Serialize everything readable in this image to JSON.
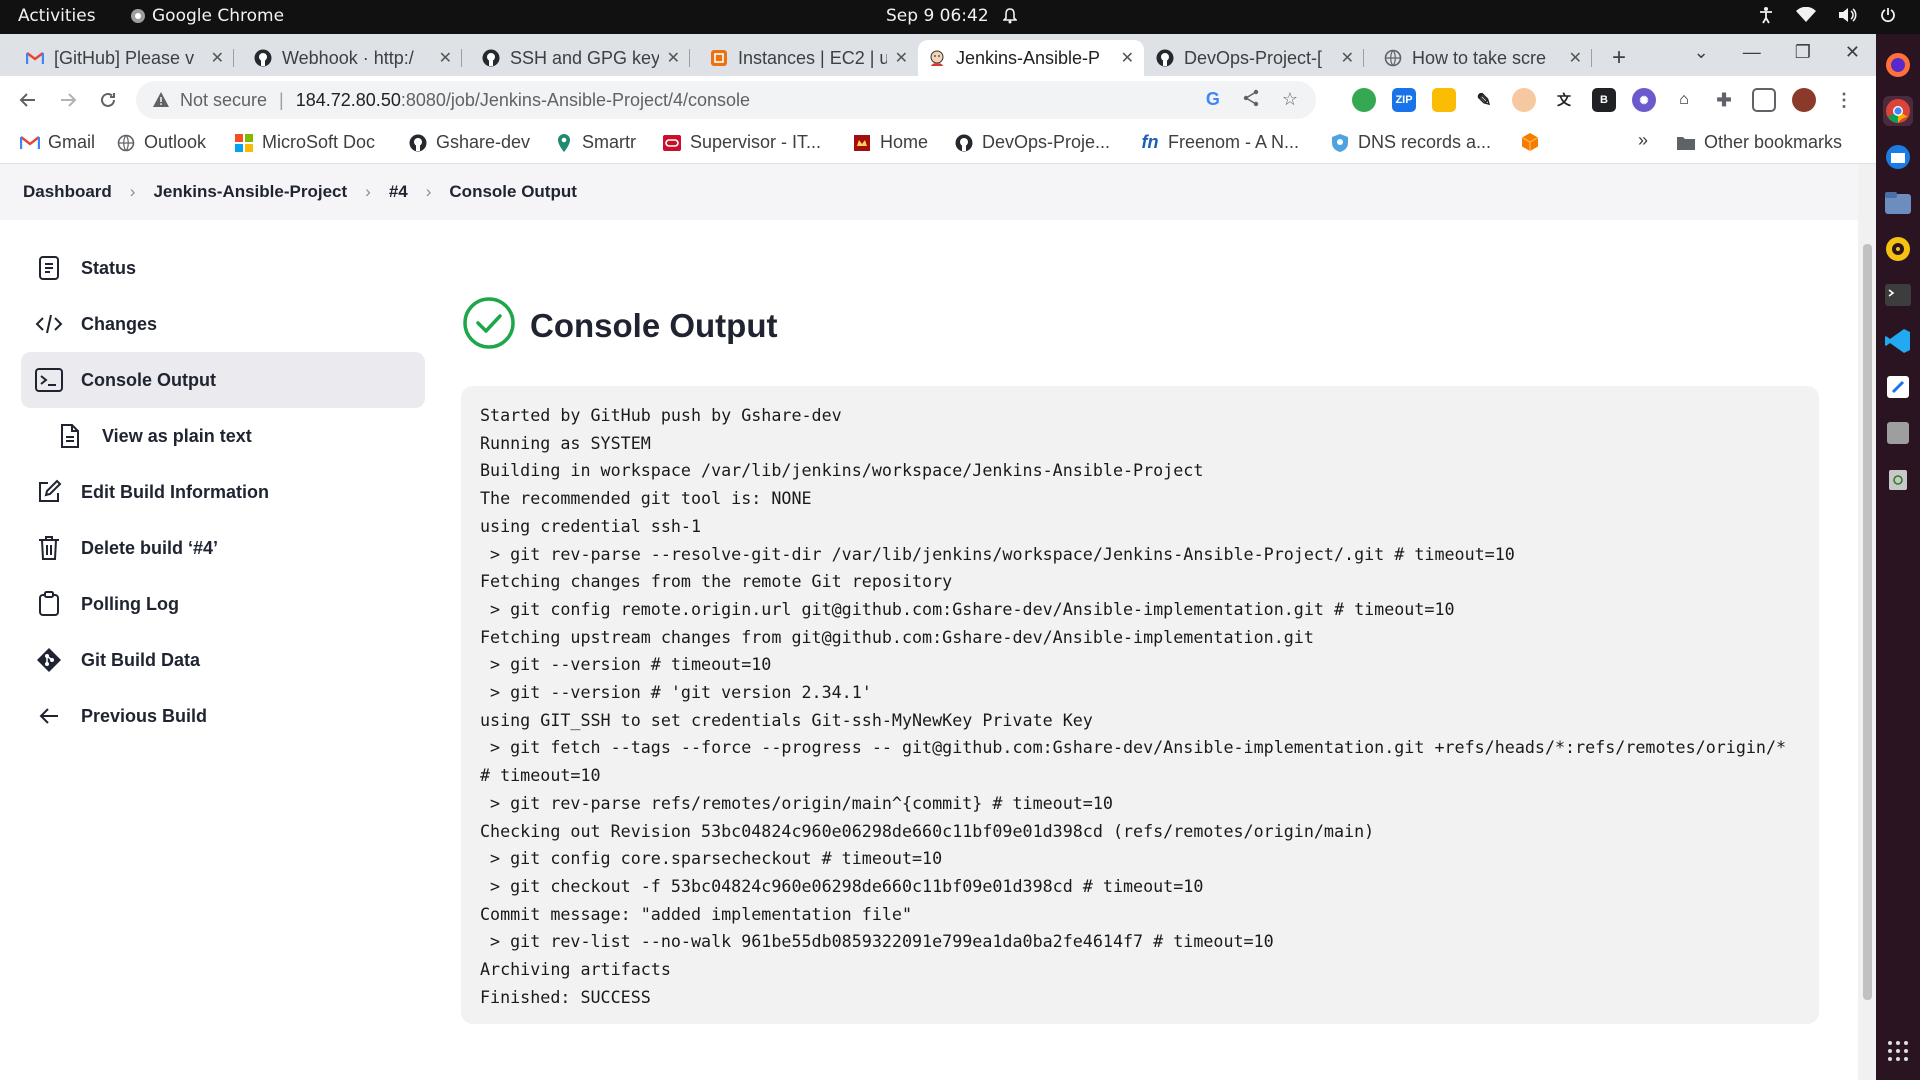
{
  "topbar": {
    "activities": "Activities",
    "app_name": "Google Chrome",
    "clock": "Sep 9  06:42"
  },
  "tabs": [
    {
      "label": "[GitHub] Please v",
      "icon": "gmail-icon",
      "active": false
    },
    {
      "label": "Webhook · http:/",
      "icon": "github-icon",
      "active": false
    },
    {
      "label": "SSH and GPG key",
      "icon": "github-icon",
      "active": false
    },
    {
      "label": "Instances | EC2 | u",
      "icon": "aws-icon",
      "active": false
    },
    {
      "label": "Jenkins-Ansible-P",
      "icon": "jenkins-icon",
      "active": true
    },
    {
      "label": "DevOps-Project-[",
      "icon": "github-icon",
      "active": false
    },
    {
      "label": "How to take scre",
      "icon": "globe-icon",
      "active": false
    }
  ],
  "toolbar": {
    "not_secure": "Not secure",
    "url_host": "184.72.80.50",
    "url_path": ":8080/job/Jenkins-Ansible-Project/4/console"
  },
  "bookmarks": [
    {
      "label": "Gmail",
      "icon": "gmail-icon"
    },
    {
      "label": "Outlook",
      "icon": "globe-icon"
    },
    {
      "label": "MicroSoft Doc",
      "icon": "microsoft-icon"
    },
    {
      "label": "Gshare-dev",
      "icon": "github-icon"
    },
    {
      "label": "Smartr",
      "icon": "smartr-icon"
    },
    {
      "label": "Supervisor - IT...",
      "icon": "supervisor-icon"
    },
    {
      "label": "Home",
      "icon": "home-icon"
    },
    {
      "label": "DevOps-Proje...",
      "icon": "github-icon"
    },
    {
      "label": "Freenom - A N...",
      "icon": "freenom-icon"
    },
    {
      "label": "DNS records a...",
      "icon": "dns-icon"
    }
  ],
  "other_bookmarks": "Other bookmarks",
  "breadcrumb": {
    "items": [
      "Dashboard",
      "Jenkins-Ansible-Project",
      "#4",
      "Console Output"
    ]
  },
  "sidebar": {
    "items": [
      {
        "label": "Status",
        "icon": "status-icon"
      },
      {
        "label": "Changes",
        "icon": "code-icon"
      },
      {
        "label": "Console Output",
        "icon": "terminal-icon",
        "active": true
      },
      {
        "label": "View as plain text",
        "icon": "document-icon",
        "sub": true
      },
      {
        "label": "Edit Build Information",
        "icon": "edit-icon"
      },
      {
        "label": "Delete build ‘#4’",
        "icon": "trash-icon"
      },
      {
        "label": "Polling Log",
        "icon": "clipboard-icon"
      },
      {
        "label": "Git Build Data",
        "icon": "git-icon"
      },
      {
        "label": "Previous Build",
        "icon": "arrow-left-icon"
      }
    ]
  },
  "main": {
    "title": "Console Output",
    "status_color": "#1ea64b"
  },
  "console": {
    "lines": [
      "Started by GitHub push by Gshare-dev",
      "Running as SYSTEM",
      "Building in workspace /var/lib/jenkins/workspace/Jenkins-Ansible-Project",
      "The recommended git tool is: NONE",
      "using credential ssh-1",
      " > git rev-parse --resolve-git-dir /var/lib/jenkins/workspace/Jenkins-Ansible-Project/.git # timeout=10",
      "Fetching changes from the remote Git repository",
      " > git config remote.origin.url git@github.com:Gshare-dev/Ansible-implementation.git # timeout=10",
      "Fetching upstream changes from git@github.com:Gshare-dev/Ansible-implementation.git",
      " > git --version # timeout=10",
      " > git --version # 'git version 2.34.1'",
      "using GIT_SSH to set credentials Git-ssh-MyNewKey Private Key",
      " > git fetch --tags --force --progress -- git@github.com:Gshare-dev/Ansible-implementation.git +refs/heads/*:refs/remotes/origin/* # timeout=10",
      " > git rev-parse refs/remotes/origin/main^{commit} # timeout=10",
      "Checking out Revision 53bc04824c960e06298de660c11bf09e01d398cd (refs/remotes/origin/main)",
      " > git config core.sparsecheckout # timeout=10",
      " > git checkout -f 53bc04824c960e06298de660c11bf09e01d398cd # timeout=10",
      "Commit message: \"added implementation file\"",
      " > git rev-list --no-walk 961be55db0859322091e799ea1da0ba2fe4614f7 # timeout=10",
      "Archiving artifacts",
      "Finished: SUCCESS"
    ]
  }
}
